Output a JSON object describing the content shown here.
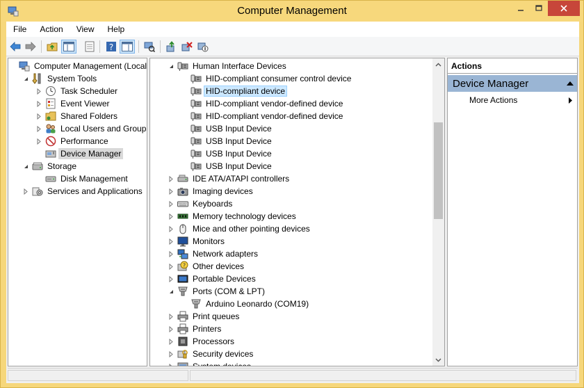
{
  "window": {
    "title": "Computer Management"
  },
  "menubar": {
    "items": [
      "File",
      "Action",
      "View",
      "Help"
    ]
  },
  "toolbar": {
    "buttons": [
      "back-arrow-icon",
      "forward-arrow-icon",
      "up-folder-icon",
      "show-hide-tree-icon",
      "properties-icon",
      "help-icon",
      "show-hide-action-pane-icon",
      "scan-hardware-icon",
      "update-driver-icon",
      "uninstall-device-icon",
      "disable-device-icon"
    ]
  },
  "nav_tree": [
    {
      "label": "Computer Management (Local)",
      "level": 0,
      "expander": "none",
      "icon": "computer-management-icon"
    },
    {
      "label": "System Tools",
      "level": 1,
      "expander": "expanded",
      "icon": "tools-icon"
    },
    {
      "label": "Task Scheduler",
      "level": 2,
      "expander": "collapsed",
      "icon": "clock-icon"
    },
    {
      "label": "Event Viewer",
      "level": 2,
      "expander": "collapsed",
      "icon": "event-viewer-icon"
    },
    {
      "label": "Shared Folders",
      "level": 2,
      "expander": "collapsed",
      "icon": "shared-folder-icon"
    },
    {
      "label": "Local Users and Groups",
      "level": 2,
      "expander": "collapsed",
      "icon": "users-icon"
    },
    {
      "label": "Performance",
      "level": 2,
      "expander": "collapsed",
      "icon": "performance-icon"
    },
    {
      "label": "Device Manager",
      "level": 2,
      "expander": "none",
      "icon": "device-manager-icon",
      "selected": true
    },
    {
      "label": "Storage",
      "level": 1,
      "expander": "expanded",
      "icon": "storage-icon"
    },
    {
      "label": "Disk Management",
      "level": 2,
      "expander": "none",
      "icon": "disk-icon"
    },
    {
      "label": "Services and Applications",
      "level": 1,
      "expander": "collapsed",
      "icon": "services-icon"
    }
  ],
  "device_tree": [
    {
      "label": "Human Interface Devices",
      "level": 0,
      "expander": "expanded",
      "icon": "hid-icon"
    },
    {
      "label": "HID-compliant consumer control device",
      "level": 1,
      "expander": "none",
      "icon": "hid-icon"
    },
    {
      "label": "HID-compliant device",
      "level": 1,
      "expander": "none",
      "icon": "hid-icon",
      "selected": true
    },
    {
      "label": "HID-compliant vendor-defined device",
      "level": 1,
      "expander": "none",
      "icon": "hid-icon"
    },
    {
      "label": "HID-compliant vendor-defined device",
      "level": 1,
      "expander": "none",
      "icon": "hid-icon"
    },
    {
      "label": "USB Input Device",
      "level": 1,
      "expander": "none",
      "icon": "hid-icon"
    },
    {
      "label": "USB Input Device",
      "level": 1,
      "expander": "none",
      "icon": "hid-icon"
    },
    {
      "label": "USB Input Device",
      "level": 1,
      "expander": "none",
      "icon": "hid-icon"
    },
    {
      "label": "USB Input Device",
      "level": 1,
      "expander": "none",
      "icon": "hid-icon"
    },
    {
      "label": "IDE ATA/ATAPI controllers",
      "level": 0,
      "expander": "collapsed",
      "icon": "ide-controller-icon"
    },
    {
      "label": "Imaging devices",
      "level": 0,
      "expander": "collapsed",
      "icon": "camera-icon"
    },
    {
      "label": "Keyboards",
      "level": 0,
      "expander": "collapsed",
      "icon": "keyboard-icon"
    },
    {
      "label": "Memory technology devices",
      "level": 0,
      "expander": "collapsed",
      "icon": "memory-icon"
    },
    {
      "label": "Mice and other pointing devices",
      "level": 0,
      "expander": "collapsed",
      "icon": "mouse-icon"
    },
    {
      "label": "Monitors",
      "level": 0,
      "expander": "collapsed",
      "icon": "monitor-icon"
    },
    {
      "label": "Network adapters",
      "level": 0,
      "expander": "collapsed",
      "icon": "network-icon"
    },
    {
      "label": "Other devices",
      "level": 0,
      "expander": "collapsed",
      "icon": "unknown-device-icon"
    },
    {
      "label": "Portable Devices",
      "level": 0,
      "expander": "collapsed",
      "icon": "portable-device-icon"
    },
    {
      "label": "Ports (COM & LPT)",
      "level": 0,
      "expander": "expanded",
      "icon": "port-icon"
    },
    {
      "label": "Arduino Leonardo (COM19)",
      "level": 1,
      "expander": "none",
      "icon": "port-icon"
    },
    {
      "label": "Print queues",
      "level": 0,
      "expander": "collapsed",
      "icon": "printer-icon"
    },
    {
      "label": "Printers",
      "level": 0,
      "expander": "collapsed",
      "icon": "printer-icon"
    },
    {
      "label": "Processors",
      "level": 0,
      "expander": "collapsed",
      "icon": "processor-icon"
    },
    {
      "label": "Security devices",
      "level": 0,
      "expander": "collapsed",
      "icon": "security-icon"
    },
    {
      "label": "System devices",
      "level": 0,
      "expander": "collapsed",
      "icon": "system-icon",
      "clipped": true
    }
  ],
  "scroll": {
    "position_fraction": 0.28,
    "visible_fraction": 0.55
  },
  "actions": {
    "header": "Actions",
    "section": "Device Manager",
    "items": [
      "More Actions"
    ]
  },
  "colors": {
    "titlebar": "#f7d87c",
    "close_button": "#c7463a",
    "actions_section": "#9ab5d4",
    "selection_blue": "#cce8ff",
    "selection_grey": "#d9d9d9"
  }
}
